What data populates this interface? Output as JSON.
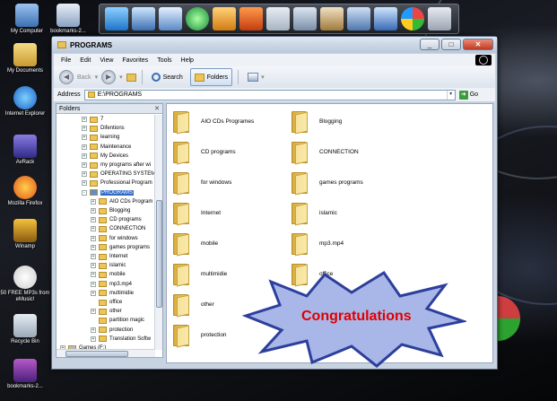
{
  "desktop": {
    "icons": [
      {
        "label": "My Computer"
      },
      {
        "label": "bookmarks-2..."
      },
      {
        "label": "My Documents"
      },
      {
        "label": "Internet Explorer"
      },
      {
        "label": "AvRack"
      },
      {
        "label": "Mozilla Firefox"
      },
      {
        "label": "Winamp"
      },
      {
        "label": "50 FREE MP3s from eMusic!"
      },
      {
        "label": "Recycle Bin"
      },
      {
        "label": "bookmarks-2..."
      }
    ]
  },
  "window": {
    "title": "PROGRAMS",
    "menu": [
      "File",
      "Edit",
      "View",
      "Favorites",
      "Tools",
      "Help"
    ],
    "toolbar": {
      "back": "Back",
      "search": "Search",
      "folders": "Folders"
    },
    "address": {
      "label": "Address",
      "value": "E:\\PROGRAMS",
      "go": "Go"
    },
    "folders_pane": {
      "title": "Folders",
      "tree": [
        {
          "label": "7",
          "indent": 1,
          "expander": "+"
        },
        {
          "label": "Difentions",
          "indent": 1,
          "expander": "+"
        },
        {
          "label": "learning",
          "indent": 1,
          "expander": "+"
        },
        {
          "label": "Maintenance",
          "indent": 1,
          "expander": "+"
        },
        {
          "label": "My Devices",
          "indent": 1,
          "expander": "+"
        },
        {
          "label": "my programs after wi",
          "indent": 1,
          "expander": "+"
        },
        {
          "label": "OPERATING SYSTEMS",
          "indent": 1,
          "expander": "+"
        },
        {
          "label": "Professional Program",
          "indent": 1,
          "expander": "+"
        },
        {
          "label": "PROGRAMS",
          "indent": 1,
          "expander": "-",
          "selected": true
        },
        {
          "label": "AIO CDs Program",
          "indent": 2,
          "expander": "+"
        },
        {
          "label": "Blogging",
          "indent": 2,
          "expander": "+"
        },
        {
          "label": "CD programs",
          "indent": 2,
          "expander": "+"
        },
        {
          "label": "CONNECTION",
          "indent": 2,
          "expander": "+"
        },
        {
          "label": "for windows",
          "indent": 2,
          "expander": "+"
        },
        {
          "label": "games programs",
          "indent": 2,
          "expander": "+"
        },
        {
          "label": "Internet",
          "indent": 2,
          "expander": "+"
        },
        {
          "label": "islamic",
          "indent": 2,
          "expander": "+"
        },
        {
          "label": "mobile",
          "indent": 2,
          "expander": "+"
        },
        {
          "label": "mp3.mp4",
          "indent": 2,
          "expander": "+"
        },
        {
          "label": "multimidie",
          "indent": 2,
          "expander": "+"
        },
        {
          "label": "office",
          "indent": 2,
          "expander": ""
        },
        {
          "label": "other",
          "indent": 2,
          "expander": "+"
        },
        {
          "label": "partition magic",
          "indent": 2,
          "expander": ""
        },
        {
          "label": "protection",
          "indent": 2,
          "expander": "+"
        },
        {
          "label": "Translation Softw",
          "indent": 2,
          "expander": "+"
        },
        {
          "label": "Games (F:)",
          "indent": 0,
          "expander": "+"
        }
      ]
    },
    "content": {
      "folders_left": [
        "AIO CDs Programes",
        "CD programs",
        "for windows",
        "Internet",
        "mobile",
        "multimidie",
        "other",
        "protection"
      ],
      "folders_right": [
        "Blogging",
        "CONNECTION",
        "games programs",
        "islamic",
        "mp3.mp4",
        "office"
      ]
    }
  },
  "overlay": {
    "text": "Congratulations"
  }
}
